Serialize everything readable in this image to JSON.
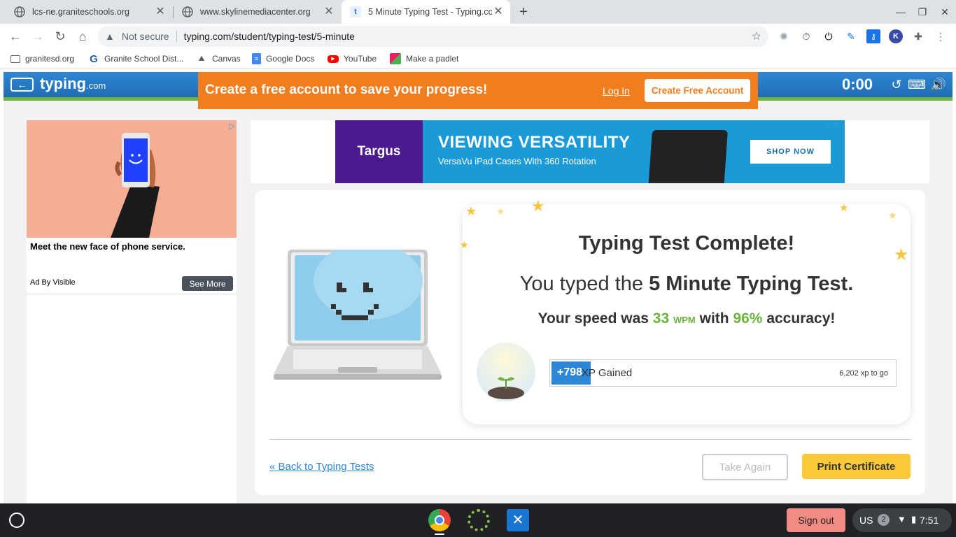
{
  "browser": {
    "tabs": [
      {
        "label": "lcs-ne.graniteschools.org",
        "active": false
      },
      {
        "label": "www.skylinemediacenter.org",
        "active": false
      },
      {
        "label": "5 Minute Typing Test - Typing.co",
        "active": true
      }
    ],
    "new_tab": "+",
    "security_label": "Not secure",
    "url": "typing.com/student/typing-test/5-minute",
    "bookmarks": [
      "granitesd.org",
      "Granite School Dist...",
      "Canvas",
      "Google Docs",
      "YouTube",
      "Make a padlet"
    ]
  },
  "site": {
    "logo_main": "typing",
    "logo_suffix": ".com",
    "timer": "0:00",
    "banner": {
      "message": "Create a free account to save your progress!",
      "login": "Log In",
      "create": "Create Free Account"
    }
  },
  "left_ad": {
    "headline": "Meet the new face of phone service.",
    "ad_by": "Ad By Visible",
    "cta": "See More"
  },
  "top_ad": {
    "brand": "Targus",
    "title": "VIEWING VERSATILITY",
    "subtitle": "VersaVu iPad Cases With 360 Rotation",
    "cta": "SHOP NOW"
  },
  "result": {
    "title": "Typing Test Complete!",
    "typed_prefix": "You typed the",
    "test_name": "5 Minute Typing Test.",
    "speed_prefix": "Your speed was",
    "wpm": "33",
    "wpm_unit": "WPM",
    "with": "with",
    "accuracy": "96%",
    "accuracy_suffix": "accuracy!",
    "xp_gained": "+798",
    "xp_label": "XP Gained",
    "xp_to_go": "6,202 xp to go",
    "xp_progress": 0.115
  },
  "actions": {
    "back": "« Back to Typing Tests",
    "again": "Take Again",
    "print": "Print Certificate"
  },
  "shelf": {
    "signout": "Sign out",
    "locale": "US",
    "notifications": "2",
    "time": "7:51"
  },
  "colors": {
    "banner": "#f07e1f",
    "topbar": "#2f87d3",
    "green": "#6db33f",
    "xp_fill": "#2d86d6",
    "print_button": "#f9c93a"
  }
}
